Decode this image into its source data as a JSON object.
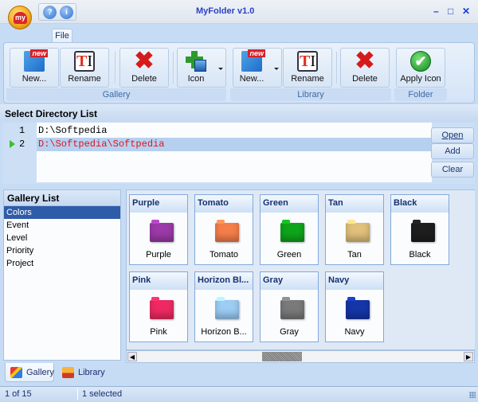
{
  "window": {
    "title": "MyFolder v1.0",
    "controls": [
      "minimize",
      "maximize",
      "close"
    ]
  },
  "quick_access": [
    {
      "name": "help",
      "glyph": "?"
    },
    {
      "name": "info",
      "glyph": "i"
    }
  ],
  "menu": {
    "file_label": "File"
  },
  "ribbon": {
    "groups": [
      {
        "label": "Gallery",
        "buttons": [
          {
            "label": "New...",
            "icon": "new-icon"
          },
          {
            "label": "Rename",
            "icon": "rename-icon"
          },
          {
            "label": "Delete",
            "icon": "delete-icon"
          },
          {
            "label": "Icon",
            "icon": "add-icon-icon",
            "dropdown": true
          }
        ]
      },
      {
        "label": "Library",
        "buttons": [
          {
            "label": "New...",
            "icon": "new-icon",
            "dropdown": true
          },
          {
            "label": "Rename",
            "icon": "rename-icon"
          },
          {
            "label": "Delete",
            "icon": "delete-icon"
          }
        ]
      },
      {
        "label": "Folder",
        "buttons": [
          {
            "label": "Apply Icon",
            "icon": "apply-icon-icon"
          }
        ]
      }
    ]
  },
  "directory": {
    "header": "Select Directory List",
    "lines": [
      {
        "num": "1",
        "path": "D:\\Softpedia",
        "selected": false
      },
      {
        "num": "2",
        "path": "D:\\Softpedia\\Softpedia",
        "selected": true
      }
    ],
    "buttons": {
      "open": "Open",
      "add": "Add",
      "clear": "Clear"
    }
  },
  "gallery_list": {
    "header": "Gallery List",
    "items": [
      "Colors",
      "Event",
      "Level",
      "Priority",
      "Project"
    ],
    "selected": "Colors"
  },
  "gallery": {
    "cards": [
      {
        "title": "Purple",
        "name": "Purple",
        "color": "#9b3aa8"
      },
      {
        "title": "Tomato",
        "name": "Tomato",
        "color": "#f57f4a"
      },
      {
        "title": "Green",
        "name": "Green",
        "color": "#0ea51a"
      },
      {
        "title": "Tan",
        "name": "Tan",
        "color": "#e0c07a"
      },
      {
        "title": "Black",
        "name": "Black",
        "color": "#1e1e1e"
      },
      {
        "title": "Pink",
        "name": "Pink",
        "color": "#ee2a62"
      },
      {
        "title": "Horizon Bl...",
        "name": "Horizon B...",
        "color": "#9ccdf5"
      },
      {
        "title": "Gray",
        "name": "Gray",
        "color": "#7a7a7a"
      },
      {
        "title": "Navy",
        "name": "Navy",
        "color": "#1536a8"
      }
    ]
  },
  "tabs": [
    {
      "label": "Gallery",
      "active": true
    },
    {
      "label": "Library",
      "active": false
    }
  ],
  "status": {
    "position": "1 of 15",
    "selection": "1 selected"
  }
}
